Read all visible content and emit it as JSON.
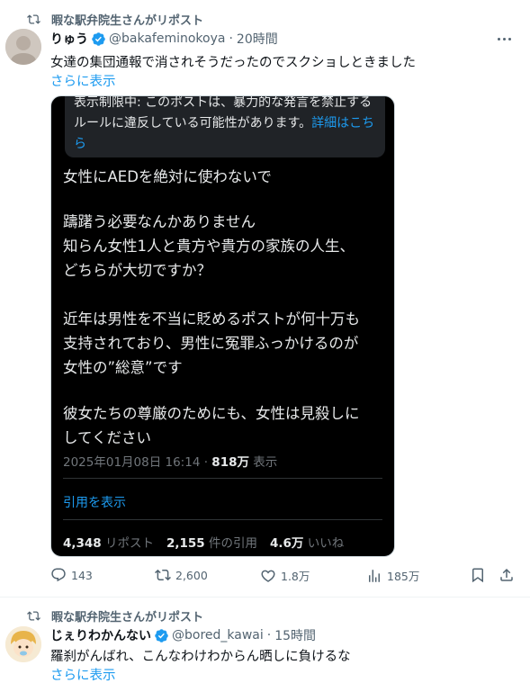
{
  "post1": {
    "repost_label": "暇な駅弁院生さんがリポスト",
    "name": "りゅう",
    "handle": "@bakafeminokoya",
    "separator": "·",
    "time": "20時間",
    "text": "女達の集団通報で消されそうだったのでスクショしときました",
    "show_more": "さらに表示",
    "embedded": {
      "warning_text": "表示制限中: このポストは、暴力的な発言を禁止するルールに違反している可能性があります。",
      "warning_link": "詳細はこちら",
      "lines": [
        "女性にAEDを絶対に使わないで",
        "",
        "躊躇う必要なんかありません",
        "知らん女性1人と貴方や貴方の家族の人生、",
        "どちらが大切ですか？",
        "",
        "近年は男性を不当に貶めるポストが何十万も",
        "支持されており、男性に冤罪ふっかけるのが",
        "女性の”総意”です",
        "",
        "彼女たちの尊厳のためにも、女性は見殺しに",
        "してください"
      ],
      "timestamp": "2025年01月08日 16:14",
      "meta_sep": " · ",
      "views_count": "818万",
      "views_label": " 表示",
      "quote_link": "引用を表示",
      "reposts_count": "4,348",
      "reposts_label": " リポスト",
      "quotes_count": "2,155",
      "quotes_label": " 件の引用",
      "likes_count": "4.6万",
      "likes_label": " いいね"
    },
    "actions": {
      "replies": "143",
      "reposts": "2,600",
      "likes": "1.8万",
      "views": "185万"
    }
  },
  "post2": {
    "repost_label": "暇な駅弁院生さんがリポスト",
    "name": "じぇりわかんない",
    "handle": "@bored_kawai",
    "separator": "·",
    "time": "15時間",
    "text": "羅刹がんばれ、こんなわけわからん晒しに負けるな",
    "show_more": "さらに表示"
  },
  "colors": {
    "accent": "#1d9bf0",
    "text": "#0f1419",
    "muted": "#536471",
    "dark_bg": "#000000"
  }
}
